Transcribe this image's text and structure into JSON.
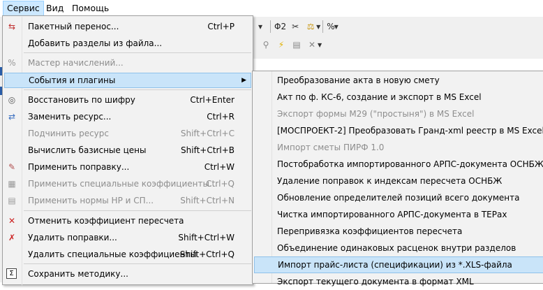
{
  "menubar": {
    "items": [
      {
        "label": "Сервис",
        "active": true
      },
      {
        "label": "Вид"
      },
      {
        "label": "Помощь"
      }
    ]
  },
  "toolbar": {
    "row1": {
      "phi_label": "Φ2",
      "percent_label": "%"
    }
  },
  "main_menu": {
    "items": [
      {
        "label": "Пакетный перенос...",
        "shortcut": "Ctrl+P",
        "icon": "batch-transfer-icon"
      },
      {
        "label": "Добавить разделы из файла...",
        "shortcut": ""
      },
      {
        "label": "Мастер начислений...",
        "shortcut": "",
        "disabled": true,
        "icon": "percent-icon"
      },
      {
        "label": "События и плагины",
        "shortcut": "",
        "submenu": true,
        "highlighted": true
      },
      {
        "label": "Восстановить по шифру",
        "shortcut": "Ctrl+Enter",
        "icon": "binoculars-icon"
      },
      {
        "label": "Заменить ресурс...",
        "shortcut": "Ctrl+R",
        "icon": "replace-icon"
      },
      {
        "label": "Подчинить ресурс",
        "shortcut": "Shift+Ctrl+C",
        "disabled": true
      },
      {
        "label": "Вычислить базисные цены",
        "shortcut": "Shift+Ctrl+B"
      },
      {
        "label": "Применить поправку...",
        "shortcut": "Ctrl+W",
        "icon": "apply-correction-icon"
      },
      {
        "label": "Применить специальные коэффициенты...",
        "shortcut": "Ctrl+Q",
        "disabled": true,
        "icon": "special-coeff-icon"
      },
      {
        "label": "Применить нормы НР и СП...",
        "shortcut": "Shift+Ctrl+N",
        "disabled": true,
        "icon": "norms-icon"
      },
      {
        "label": "Отменить коэффициент пересчета",
        "shortcut": "",
        "icon": "cancel-coeff-icon"
      },
      {
        "label": "Удалить поправки...",
        "shortcut": "Shift+Ctrl+W",
        "icon": "delete-correction-icon"
      },
      {
        "label": "Удалить специальные коэффициенты",
        "shortcut": "Shift+Ctrl+Q"
      },
      {
        "label": "Сохранить методику...",
        "shortcut": "",
        "icon": "sigma-icon"
      }
    ]
  },
  "sub_menu": {
    "items": [
      {
        "label": "Преобразование акта в новую смету"
      },
      {
        "label": "Акт по ф. КС-6, создание и экспорт в MS Excel"
      },
      {
        "label": "Экспорт формы М29 (\"простыня\") в MS Excel",
        "disabled": true
      },
      {
        "label": "[МОСПРОЕКТ-2] Преобразовать Гранд-xml реестр в MS Excel"
      },
      {
        "label": "Импорт сметы ПИРФ 1.0",
        "disabled": true
      },
      {
        "label": "Постобработка импортированного АРПС-документа ОСНБЖ"
      },
      {
        "label": "Удаление поправок к индексам пересчета ОСНБЖ"
      },
      {
        "label": "Обновление определителей позиций всего документа"
      },
      {
        "label": "Чистка импортированного АРПС-документа в ТЕРах"
      },
      {
        "label": "Перепривязка коэффициентов пересчета"
      },
      {
        "label": "Объединение одинаковых расценок внутри разделов"
      },
      {
        "label": "Импорт прайс-листа (спецификации) из *.XLS-файла",
        "highlighted": true
      },
      {
        "label": "Экспорт текущего документа в формат XML"
      }
    ]
  }
}
